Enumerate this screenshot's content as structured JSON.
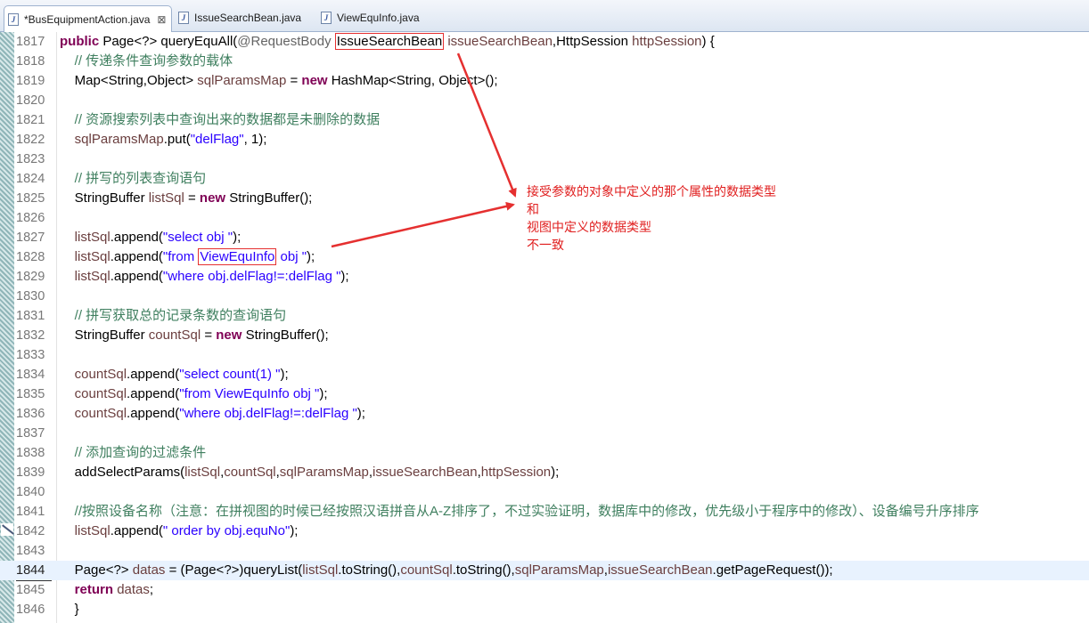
{
  "tabs": [
    {
      "label": "*BusEquipmentAction.java",
      "active": true
    },
    {
      "label": "IssueSearchBean.java",
      "active": false
    },
    {
      "label": "ViewEquInfo.java",
      "active": false
    }
  ],
  "tab_close_glyph": "⊠",
  "lines": [
    {
      "n": "1817",
      "tokens": [
        {
          "t": "kw",
          "v": "public"
        },
        {
          "t": "pl",
          "v": " Page<?> queryEquAll("
        },
        {
          "t": "an",
          "v": "@RequestBody"
        },
        {
          "t": "pl",
          "v": " "
        },
        {
          "t": "box",
          "v": "IssueSearchBean"
        },
        {
          "t": "pl",
          "v": " "
        },
        {
          "t": "lv",
          "v": "issueSearchBean"
        },
        {
          "t": "pl",
          "v": ",HttpSession "
        },
        {
          "t": "lv",
          "v": "httpSession"
        },
        {
          "t": "pl",
          "v": ") {"
        }
      ]
    },
    {
      "n": "1818",
      "tokens": [
        {
          "t": "cm",
          "v": "    // 传递条件查询参数的载体"
        }
      ]
    },
    {
      "n": "1819",
      "tokens": [
        {
          "t": "pl",
          "v": "    Map<String,Object> "
        },
        {
          "t": "lv",
          "v": "sqlParamsMap"
        },
        {
          "t": "pl",
          "v": " = "
        },
        {
          "t": "kw",
          "v": "new"
        },
        {
          "t": "pl",
          "v": " HashMap<String, Object>();"
        }
      ]
    },
    {
      "n": "1820",
      "tokens": []
    },
    {
      "n": "1821",
      "tokens": [
        {
          "t": "cm",
          "v": "    // 资源搜索列表中查询出来的数据都是未删除的数据"
        }
      ]
    },
    {
      "n": "1822",
      "tokens": [
        {
          "t": "lv",
          "v": "    sqlParamsMap"
        },
        {
          "t": "pl",
          "v": ".put("
        },
        {
          "t": "st",
          "v": "\"delFlag\""
        },
        {
          "t": "pl",
          "v": ", 1);"
        }
      ]
    },
    {
      "n": "1823",
      "tokens": []
    },
    {
      "n": "1824",
      "tokens": [
        {
          "t": "cm",
          "v": "    // 拼写的列表查询语句"
        }
      ]
    },
    {
      "n": "1825",
      "tokens": [
        {
          "t": "pl",
          "v": "    StringBuffer "
        },
        {
          "t": "lv",
          "v": "listSql"
        },
        {
          "t": "pl",
          "v": " = "
        },
        {
          "t": "kw",
          "v": "new"
        },
        {
          "t": "pl",
          "v": " StringBuffer();"
        }
      ]
    },
    {
      "n": "1826",
      "tokens": []
    },
    {
      "n": "1827",
      "tokens": [
        {
          "t": "lv",
          "v": "    listSql"
        },
        {
          "t": "pl",
          "v": ".append("
        },
        {
          "t": "st",
          "v": "\"select obj \""
        },
        {
          "t": "pl",
          "v": ");"
        }
      ]
    },
    {
      "n": "1828",
      "tokens": [
        {
          "t": "lv",
          "v": "    listSql"
        },
        {
          "t": "pl",
          "v": ".append("
        },
        {
          "t": "st",
          "v": "\"from "
        },
        {
          "t": "boxst",
          "v": "ViewEquInfo"
        },
        {
          "t": "st",
          "v": " obj \""
        },
        {
          "t": "pl",
          "v": ");"
        }
      ]
    },
    {
      "n": "1829",
      "tokens": [
        {
          "t": "lv",
          "v": "    listSql"
        },
        {
          "t": "pl",
          "v": ".append("
        },
        {
          "t": "st",
          "v": "\"where obj.delFlag!=:delFlag \""
        },
        {
          "t": "pl",
          "v": ");"
        }
      ]
    },
    {
      "n": "1830",
      "tokens": []
    },
    {
      "n": "1831",
      "tokens": [
        {
          "t": "cm",
          "v": "    // 拼写获取总的记录条数的查询语句"
        }
      ]
    },
    {
      "n": "1832",
      "tokens": [
        {
          "t": "pl",
          "v": "    StringBuffer "
        },
        {
          "t": "lv",
          "v": "countSql"
        },
        {
          "t": "pl",
          "v": " = "
        },
        {
          "t": "kw",
          "v": "new"
        },
        {
          "t": "pl",
          "v": " StringBuffer();"
        }
      ]
    },
    {
      "n": "1833",
      "tokens": []
    },
    {
      "n": "1834",
      "tokens": [
        {
          "t": "lv",
          "v": "    countSql"
        },
        {
          "t": "pl",
          "v": ".append("
        },
        {
          "t": "st",
          "v": "\"select count(1) \""
        },
        {
          "t": "pl",
          "v": ");"
        }
      ]
    },
    {
      "n": "1835",
      "tokens": [
        {
          "t": "lv",
          "v": "    countSql"
        },
        {
          "t": "pl",
          "v": ".append("
        },
        {
          "t": "st",
          "v": "\"from ViewEquInfo obj \""
        },
        {
          "t": "pl",
          "v": ");"
        }
      ]
    },
    {
      "n": "1836",
      "tokens": [
        {
          "t": "lv",
          "v": "    countSql"
        },
        {
          "t": "pl",
          "v": ".append("
        },
        {
          "t": "st",
          "v": "\"where obj.delFlag!=:delFlag \""
        },
        {
          "t": "pl",
          "v": ");"
        }
      ]
    },
    {
      "n": "1837",
      "tokens": []
    },
    {
      "n": "1838",
      "tokens": [
        {
          "t": "cm",
          "v": "    // 添加查询的过滤条件"
        }
      ]
    },
    {
      "n": "1839",
      "tokens": [
        {
          "t": "pl",
          "v": "    addSelectParams("
        },
        {
          "t": "lv",
          "v": "listSql"
        },
        {
          "t": "pl",
          "v": ","
        },
        {
          "t": "lv",
          "v": "countSql"
        },
        {
          "t": "pl",
          "v": ","
        },
        {
          "t": "lv",
          "v": "sqlParamsMap"
        },
        {
          "t": "pl",
          "v": ","
        },
        {
          "t": "lv",
          "v": "issueSearchBean"
        },
        {
          "t": "pl",
          "v": ","
        },
        {
          "t": "lv",
          "v": "httpSession"
        },
        {
          "t": "pl",
          "v": ");"
        }
      ]
    },
    {
      "n": "1840",
      "tokens": []
    },
    {
      "n": "1841",
      "tokens": [
        {
          "t": "cm",
          "v": "    //按照设备名称（注意：在拼视图的时候已经按照汉语拼音从A-Z排序了，不过实验证明，数据库中的修改，优先级小于程序中的修改）、设备编号升序排序"
        }
      ]
    },
    {
      "n": "1842",
      "tokens": [
        {
          "t": "lv",
          "v": "    listSql"
        },
        {
          "t": "pl",
          "v": ".append("
        },
        {
          "t": "st",
          "v": "\" order by obj.equNo\""
        },
        {
          "t": "pl",
          "v": ");"
        }
      ]
    },
    {
      "n": "1843",
      "tokens": []
    },
    {
      "n": "1844",
      "current": true,
      "tokens": [
        {
          "t": "pl",
          "v": "    Page<?> "
        },
        {
          "t": "lv",
          "v": "datas"
        },
        {
          "t": "pl",
          "v": " = (Page<?>)queryList("
        },
        {
          "t": "lv",
          "v": "listSql"
        },
        {
          "t": "pl",
          "v": ".toString(),"
        },
        {
          "t": "lv",
          "v": "countSql"
        },
        {
          "t": "pl",
          "v": ".toString(),"
        },
        {
          "t": "lv",
          "v": "sqlParamsMap"
        },
        {
          "t": "pl",
          "v": ","
        },
        {
          "t": "lv",
          "v": "issueSearchBean"
        },
        {
          "t": "pl",
          "v": ".getPageRequest());"
        }
      ]
    },
    {
      "n": "1845",
      "tokens": [
        {
          "t": "pl",
          "v": "    "
        },
        {
          "t": "kw",
          "v": "return"
        },
        {
          "t": "pl",
          "v": " "
        },
        {
          "t": "lv",
          "v": "datas"
        },
        {
          "t": "pl",
          "v": ";"
        }
      ]
    },
    {
      "n": "1846",
      "tokens": [
        {
          "t": "pl",
          "v": "    }"
        }
      ]
    }
  ],
  "annotation": {
    "lines": [
      "接受参数的对象中定义的那个属性的数据类型",
      "和",
      "视图中定义的数据类型",
      "不一致"
    ],
    "color": "#e01e1e"
  },
  "colors": {
    "keyword": "#7f0055",
    "comment": "#3f7f5f",
    "string": "#2a00ff",
    "local_var": "#6a3e3e",
    "annotation_kw": "#646464",
    "current_line": "#e8f2fe"
  }
}
